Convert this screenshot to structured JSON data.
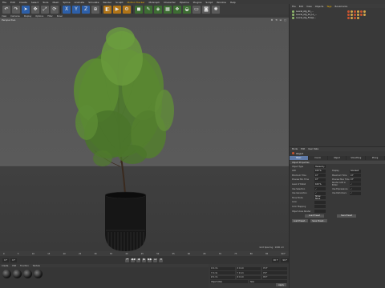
{
  "menubar": {
    "items": [
      "File",
      "Edit",
      "Create",
      "Select",
      "Tools",
      "Mesh",
      "Spline",
      "Animate",
      "Simulate",
      "Render",
      "Sculpt",
      "Motion Tracker",
      "MoGraph",
      "Character",
      "Pipeline",
      "Plugins",
      "Script",
      "Window",
      "Help"
    ],
    "highlighted": "Motion Tracker"
  },
  "toolbar": {
    "buttons": [
      "undo",
      "redo",
      "select",
      "move",
      "scale",
      "rotate",
      "x-axis",
      "y-axis",
      "z-axis",
      "coord",
      "render-view",
      "render",
      "render-settings",
      "cube",
      "pen",
      "subdivision",
      "array",
      "cloner",
      "deformer",
      "floor",
      "camera",
      "light"
    ]
  },
  "viewport": {
    "menu": [
      "View",
      "Cameras",
      "Display",
      "Options",
      "Filter",
      "Panel"
    ],
    "label": "Perspective",
    "controls": "✥ ⟲ ⊡ ▢",
    "grid_spacing": "Grid Spacing : 1000 cm"
  },
  "timeline": {
    "ticks": [
      "0",
      "5",
      "10",
      "15",
      "20",
      "25",
      "30",
      "35",
      "40",
      "45",
      "50",
      "55",
      "60",
      "65",
      "70",
      "75",
      "80",
      "85",
      "90 F"
    ]
  },
  "transport": {
    "start_frame": "0 F",
    "current_frame": "0 F",
    "end_frame": "90 F",
    "max_frame": "90 F",
    "buttons": [
      "⏮",
      "◀◀",
      "◀",
      "▶",
      "▶▶",
      "⏭",
      "⏺"
    ]
  },
  "materials": {
    "menu": [
      "Create",
      "Edit",
      "Function",
      "Texture"
    ],
    "count": 4
  },
  "coordinates": {
    "rows": [
      [
        "X 0 cm",
        "X 0 cm",
        "H 0°"
      ],
      [
        "Y 0 cm",
        "Y 0 cm",
        "P 0°"
      ],
      [
        "Z 0 cm",
        "Z 0 cm",
        "B 0°"
      ]
    ],
    "mode": "Object (Rel)",
    "size_mode": "Size",
    "apply": "Apply"
  },
  "object_manager": {
    "menu": [
      "File",
      "Edit",
      "View",
      "Objects",
      "Tags",
      "Bookmarks"
    ],
    "highlighted": "Tags",
    "objects": [
      {
        "name": "Laurel_Alg_01_...",
        "tags": 6
      },
      {
        "name": "Laurel_Alg_01_Lo_...",
        "tags": 6
      },
      {
        "name": "Laurel_Alg_Flowp...",
        "tags": 4
      }
    ]
  },
  "attributes": {
    "menu": [
      "Mode",
      "Edit",
      "User Data"
    ],
    "object_label": "Object",
    "tabs": [
      "Basic",
      "Coord.",
      "Object",
      "Smoothing",
      "Phong"
    ],
    "active_tab": "Basic",
    "section": "Object Properties",
    "props": [
      {
        "l": "Object Type",
        "v": "Hierarchy",
        "l2": "",
        "v2": ""
      },
      {
        "l": "LOD",
        "v": "100 %",
        "l2": "Display",
        "v2": "Gouraud"
      },
      {
        "l": "Minimum Time",
        "v": "0 F",
        "l2": "Maximum Time",
        "v2": "0 F"
      },
      {
        "l": "Preview Min Time",
        "v": "0 F",
        "l2": "Preview Max Time",
        "v2": "0 F"
      },
      {
        "l": "Level of Detail",
        "v": "100 %",
        "l2": "Render LOD in Editor",
        "v2": "✓"
      },
      {
        "l": "Use Selection",
        "v": "✓",
        "l2": "Use Expressions",
        "v2": "✓"
      },
      {
        "l": "Use Generators",
        "v": "✓",
        "l2": "Use Deformers",
        "v2": "✓"
      },
      {
        "l": "Show Mode",
        "v": "Show None",
        "l2": "",
        "v2": ""
      },
      {
        "l": "Color",
        "v": "",
        "l2": "",
        "v2": ""
      },
      {
        "l": "Color Mapping",
        "v": "",
        "l2": "",
        "v2": ""
      },
      {
        "l": "Object Axes Render",
        "v": "",
        "l2": "",
        "v2": ""
      }
    ],
    "load_preset": "Load Preset",
    "save_preset": "Save Preset",
    "bottom_buttons": [
      "Load Preset...",
      "Save Preset..."
    ]
  },
  "colors": {
    "accent": "#f2b400",
    "selected": "#2d5fa8",
    "tab_active": "#5f7aa7",
    "tag_red": "#c9542f"
  }
}
